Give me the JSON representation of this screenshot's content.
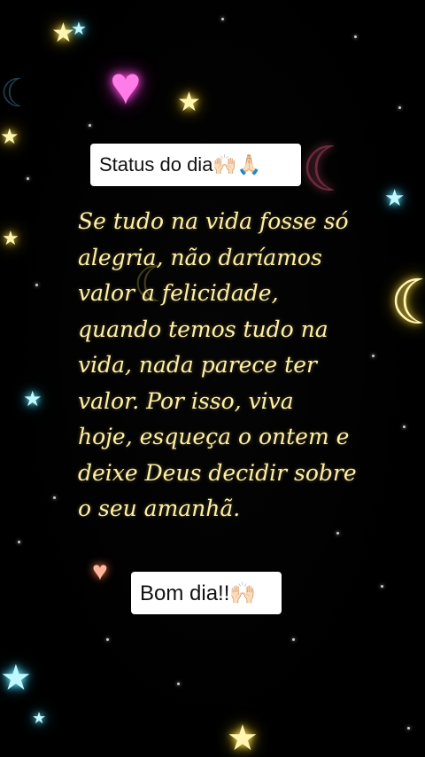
{
  "top_caption": {
    "text": "Status do dia🙌🏻🙏🏻"
  },
  "quote": {
    "lines": [
      "Se tudo na vida fosse só",
      "alegria, não daríamos",
      "valor a felicidade,",
      "quando temos tudo na",
      "vida, nada parece ter",
      "valor. Por isso, viva",
      "hoje, esqueça o ontem e",
      "deixe Deus decidir sobre",
      "o seu amanhã."
    ]
  },
  "bottom_caption": {
    "text": "Bom dia!!🙌🏻"
  },
  "colors": {
    "quote_text": "#fff0a8",
    "caption_background": "#ffffff",
    "background": "#000000"
  },
  "decorations": {
    "icons": [
      "heart-icon",
      "star-icon",
      "crescent-moon-icon",
      "sparkle-dot"
    ]
  }
}
